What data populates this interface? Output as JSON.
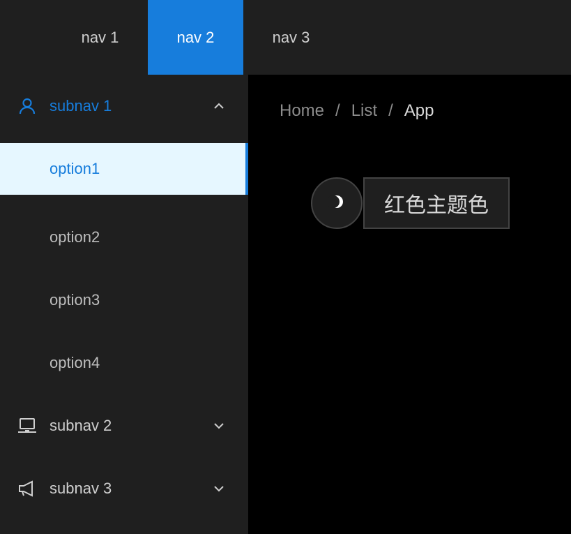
{
  "header": {
    "nav": [
      {
        "label": "nav 1"
      },
      {
        "label": "nav 2",
        "active": true
      },
      {
        "label": "nav 3"
      }
    ]
  },
  "sidebar": {
    "submenus": [
      {
        "label": "subnav 1",
        "icon": "user-icon",
        "open": true,
        "options": [
          "option1",
          "option2",
          "option3",
          "option4"
        ],
        "selected": "option1"
      },
      {
        "label": "subnav 2",
        "icon": "laptop-icon",
        "open": false
      },
      {
        "label": "subnav 3",
        "icon": "notification-icon",
        "open": false
      }
    ]
  },
  "content": {
    "breadcrumb": [
      "Home",
      "List",
      "App"
    ],
    "breadcrumb_separator": "/",
    "theme_toggle_icon": "moon-icon",
    "theme_button_label": "红色主题色"
  },
  "colors": {
    "accent": "#177ddc",
    "header_bg": "#1f1f1f",
    "content_bg": "#000000",
    "selected_bg": "#e6f7ff"
  }
}
